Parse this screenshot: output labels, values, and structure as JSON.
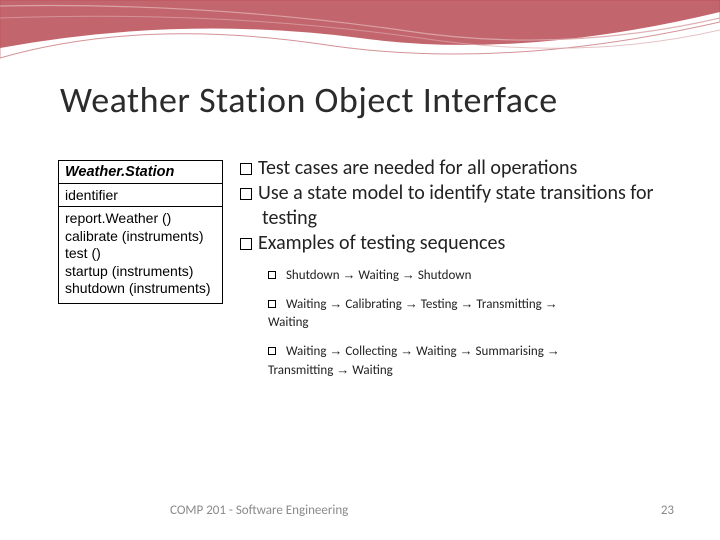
{
  "title": "Weather Station Object Interface",
  "uml": {
    "name": "Weather.Station",
    "attribute": "identifier",
    "ops": [
      "report.Weather ()",
      "calibrate (instruments)",
      "test ()",
      "startup (instruments)",
      "shutdown (instruments)"
    ]
  },
  "bullets": {
    "b1": "Test cases are needed for all operations",
    "b2": "Use a state model to identify state transitions for testing",
    "b3": "Examples of testing sequences",
    "s1_parts": [
      "Shutdown",
      "Waiting",
      "Shutdown"
    ],
    "s2_parts": [
      "Waiting",
      "Calibrating",
      "Testing",
      "Transmitting",
      "Waiting"
    ],
    "s3_parts": [
      "Waiting",
      "Collecting",
      "Waiting",
      "Summarising",
      "Transmitting",
      "Waiting"
    ]
  },
  "footer": {
    "left": "COMP 201 - Software Engineering",
    "right": "23"
  }
}
